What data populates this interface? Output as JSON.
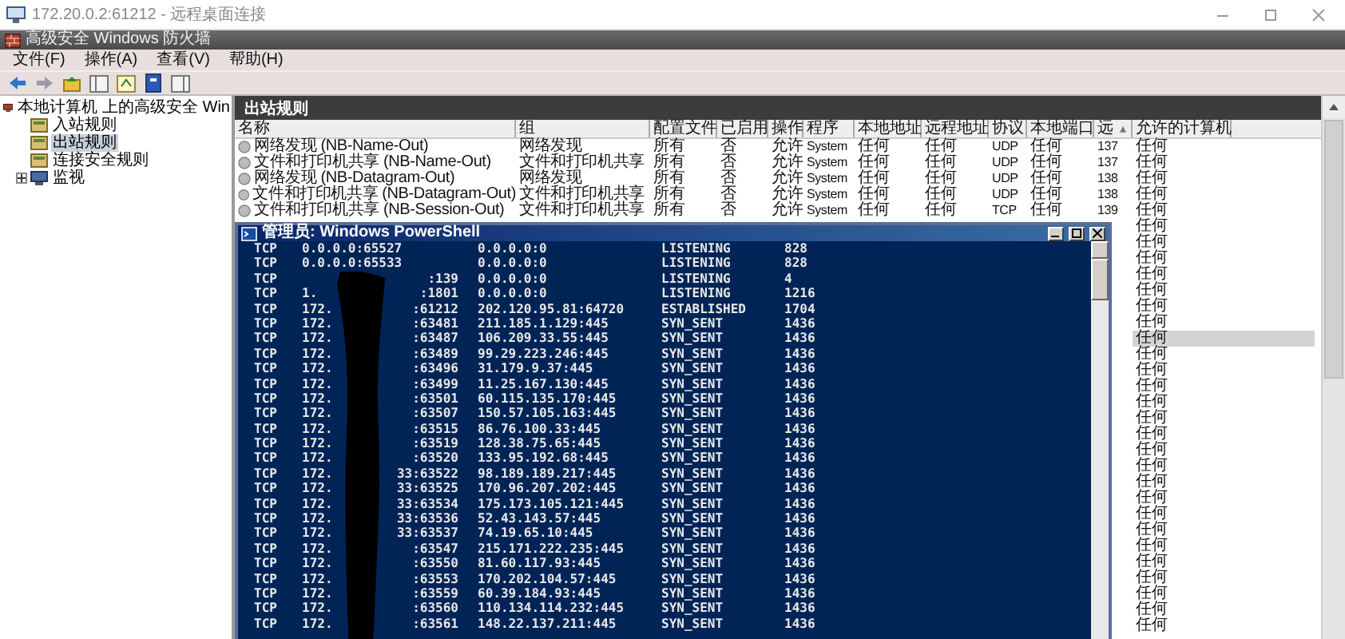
{
  "remote_window": {
    "title": "172.20.0.2:61212 - 远程桌面连接"
  },
  "app": {
    "title": "高级安全 Windows 防火墙",
    "menu": [
      "文件(F)",
      "操作(A)",
      "查看(V)",
      "帮助(H)"
    ]
  },
  "tree": {
    "root": "本地计算机 上的高级安全 Win",
    "items": [
      {
        "label": "入站规则",
        "kind": "rule",
        "selected": false
      },
      {
        "label": "出站规则",
        "kind": "rule",
        "selected": true
      },
      {
        "label": "连接安全规则",
        "kind": "rule",
        "selected": false
      },
      {
        "label": "监视",
        "kind": "collapsed-group",
        "selected": false
      }
    ]
  },
  "panel": {
    "title": "出站规则",
    "columns": [
      {
        "label": "名称"
      },
      {
        "label": "组"
      },
      {
        "label": "配置文件"
      },
      {
        "label": "已启用"
      },
      {
        "label": "操作"
      },
      {
        "label": "程序"
      },
      {
        "label": "本地地址"
      },
      {
        "label": "远程地址"
      },
      {
        "label": "协议"
      },
      {
        "label": "本地端口"
      },
      {
        "label": "远",
        "sort_mark": "▴"
      },
      {
        "label": "允许的计算机"
      }
    ],
    "rows": [
      {
        "cells": [
          "网络发现 (NB-Name-Out)",
          "网络发现",
          "所有",
          "否",
          "允许",
          "System",
          "任何",
          "任何",
          "UDP",
          "任何",
          "137",
          "任何"
        ],
        "selected": false
      },
      {
        "cells": [
          "文件和打印机共享 (NB-Name-Out)",
          "文件和打印机共享",
          "所有",
          "否",
          "允许",
          "System",
          "任何",
          "任何",
          "UDP",
          "任何",
          "137",
          "任何"
        ],
        "selected": false
      },
      {
        "cells": [
          "网络发现 (NB-Datagram-Out)",
          "网络发现",
          "所有",
          "否",
          "允许",
          "System",
          "任何",
          "任何",
          "UDP",
          "任何",
          "138",
          "任何"
        ],
        "selected": false
      },
      {
        "cells": [
          "文件和打印机共享 (NB-Datagram-Out)",
          "文件和打印机共享",
          "所有",
          "否",
          "允许",
          "System",
          "任何",
          "任何",
          "UDP",
          "任何",
          "138",
          "任何"
        ],
        "selected": false
      },
      {
        "cells": [
          "文件和打印机共享 (NB-Session-Out)",
          "文件和打印机共享",
          "所有",
          "否",
          "允许",
          "System",
          "任何",
          "任何",
          "TCP",
          "任何",
          "139",
          "任何"
        ],
        "selected": false
      }
    ],
    "more_rows": [
      {
        "allowed_computers": "任何",
        "selected": false
      },
      {
        "allowed_computers": "任何",
        "selected": false
      },
      {
        "allowed_computers": "任何",
        "selected": false
      },
      {
        "allowed_computers": "任何",
        "selected": false
      },
      {
        "allowed_computers": "任何",
        "selected": false
      },
      {
        "allowed_computers": "任何",
        "selected": false
      },
      {
        "allowed_computers": "任何",
        "selected": false
      },
      {
        "allowed_computers": "任何",
        "selected": true
      },
      {
        "allowed_computers": "任何",
        "selected": false
      },
      {
        "allowed_computers": "任何",
        "selected": false
      },
      {
        "allowed_computers": "任何",
        "selected": false
      },
      {
        "allowed_computers": "任何",
        "selected": false
      },
      {
        "allowed_computers": "任何",
        "selected": false
      },
      {
        "allowed_computers": "任何",
        "selected": false
      },
      {
        "allowed_computers": "任何",
        "selected": false
      },
      {
        "allowed_computers": "任何",
        "selected": false
      },
      {
        "allowed_computers": "任何",
        "selected": false
      },
      {
        "allowed_computers": "任何",
        "selected": false
      },
      {
        "allowed_computers": "任何",
        "selected": false
      },
      {
        "allowed_computers": "任何",
        "selected": false
      },
      {
        "allowed_computers": "任何",
        "selected": false
      },
      {
        "allowed_computers": "任何",
        "selected": false
      },
      {
        "allowed_computers": "任何",
        "selected": false
      },
      {
        "allowed_computers": "任何",
        "selected": false
      },
      {
        "allowed_computers": "任何",
        "selected": false
      },
      {
        "allowed_computers": "任何",
        "selected": false
      }
    ]
  },
  "powershell": {
    "title": "管理员: Windows PowerShell",
    "rows": [
      {
        "proto": "TCP",
        "local_start": "0.0.0.0:65527",
        "foreign": "0.0.0.0:0",
        "state": "LISTENING",
        "pid": "828"
      },
      {
        "proto": "TCP",
        "local_start": "0.0.0.0:65533",
        "foreign": "0.0.0.0:0",
        "state": "LISTENING",
        "pid": "828"
      },
      {
        "proto": "TCP",
        "local_end": ":139",
        "foreign": "0.0.0.0:0",
        "state": "LISTENING",
        "pid": "4"
      },
      {
        "proto": "TCP",
        "local_start": "1.",
        "local_end": ":1801",
        "foreign": "0.0.0.0:0",
        "state": "LISTENING",
        "pid": "1216"
      },
      {
        "proto": "TCP",
        "local_start": "172.",
        "local_end": ":61212",
        "foreign": "202.120.95.81:64720",
        "state": "ESTABLISHED",
        "pid": "1704"
      },
      {
        "proto": "TCP",
        "local_start": "172.",
        "local_end": ":63481",
        "foreign": "211.185.1.129:445",
        "state": "SYN_SENT",
        "pid": "1436"
      },
      {
        "proto": "TCP",
        "local_start": "172.",
        "local_end": ":63487",
        "foreign": "106.209.33.55:445",
        "state": "SYN_SENT",
        "pid": "1436"
      },
      {
        "proto": "TCP",
        "local_start": "172.",
        "local_end": ":63489",
        "foreign": "99.29.223.246:445",
        "state": "SYN_SENT",
        "pid": "1436"
      },
      {
        "proto": "TCP",
        "local_start": "172.",
        "local_end": ":63496",
        "foreign": "31.179.9.37:445",
        "state": "SYN_SENT",
        "pid": "1436"
      },
      {
        "proto": "TCP",
        "local_start": "172.",
        "local_end": ":63499",
        "foreign": "11.25.167.130:445",
        "state": "SYN_SENT",
        "pid": "1436"
      },
      {
        "proto": "TCP",
        "local_start": "172.",
        "local_end": ":63501",
        "foreign": "60.115.135.170:445",
        "state": "SYN_SENT",
        "pid": "1436"
      },
      {
        "proto": "TCP",
        "local_start": "172.",
        "local_end": ":63507",
        "foreign": "150.57.105.163:445",
        "state": "SYN_SENT",
        "pid": "1436"
      },
      {
        "proto": "TCP",
        "local_start": "172.",
        "local_end": ":63515",
        "foreign": "86.76.100.33:445",
        "state": "SYN_SENT",
        "pid": "1436"
      },
      {
        "proto": "TCP",
        "local_start": "172.",
        "local_end": ":63519",
        "foreign": "128.38.75.65:445",
        "state": "SYN_SENT",
        "pid": "1436"
      },
      {
        "proto": "TCP",
        "local_start": "172.",
        "local_end": ":63520",
        "foreign": "133.95.192.68:445",
        "state": "SYN_SENT",
        "pid": "1436"
      },
      {
        "proto": "TCP",
        "local_start": "172.",
        "local_end": "33:63522",
        "foreign": "98.189.189.217:445",
        "state": "SYN_SENT",
        "pid": "1436"
      },
      {
        "proto": "TCP",
        "local_start": "172.",
        "local_end": "33:63525",
        "foreign": "170.96.207.202:445",
        "state": "SYN_SENT",
        "pid": "1436"
      },
      {
        "proto": "TCP",
        "local_start": "172.",
        "local_end": "33:63534",
        "foreign": "175.173.105.121:445",
        "state": "SYN_SENT",
        "pid": "1436"
      },
      {
        "proto": "TCP",
        "local_start": "172.",
        "local_end": "33:63536",
        "foreign": "52.43.143.57:445",
        "state": "SYN_SENT",
        "pid": "1436"
      },
      {
        "proto": "TCP",
        "local_start": "172.",
        "local_end": "33:63537",
        "foreign": "74.19.65.10:445",
        "state": "SYN_SENT",
        "pid": "1436"
      },
      {
        "proto": "TCP",
        "local_start": "172.",
        "local_end": ":63547",
        "foreign": "215.171.222.235:445",
        "state": "SYN_SENT",
        "pid": "1436"
      },
      {
        "proto": "TCP",
        "local_start": "172.",
        "local_end": ":63550",
        "foreign": "81.60.117.93:445",
        "state": "SYN_SENT",
        "pid": "1436"
      },
      {
        "proto": "TCP",
        "local_start": "172.",
        "local_end": ":63553",
        "foreign": "170.202.104.57:445",
        "state": "SYN_SENT",
        "pid": "1436"
      },
      {
        "proto": "TCP",
        "local_start": "172.",
        "local_end": ":63559",
        "foreign": "60.39.184.93:445",
        "state": "SYN_SENT",
        "pid": "1436"
      },
      {
        "proto": "TCP",
        "local_start": "172.",
        "local_end": ":63560",
        "foreign": "110.134.114.232:445",
        "state": "SYN_SENT",
        "pid": "1436"
      },
      {
        "proto": "TCP",
        "local_start": "172.",
        "local_end": ":63561",
        "foreign": "148.22.137.211:445",
        "state": "SYN_SENT",
        "pid": "1436"
      }
    ]
  }
}
